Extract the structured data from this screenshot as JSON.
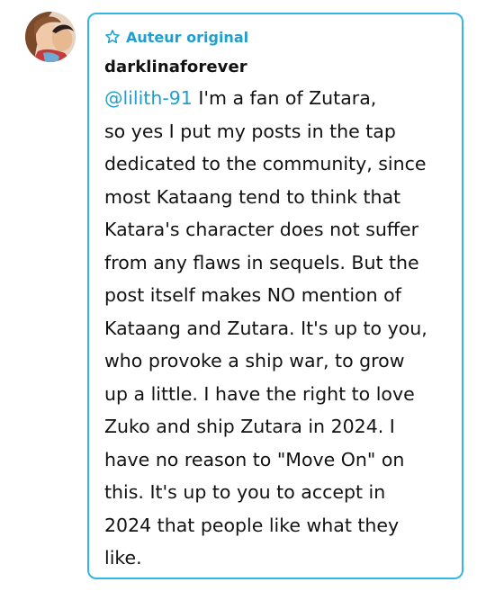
{
  "post": {
    "badge_icon": "star-outline-icon",
    "badge_label": "Auteur original",
    "username": "darklinaforever",
    "mention": "@lilith-91",
    "lines": [
      " I'm a fan of Zutara,",
      "so yes I put my posts in the tap",
      "dedicated to the community, since",
      "most Kataang tend to think that",
      "Katara's character does not suffer",
      "from any flaws in sequels. But the",
      "post itself makes NO mention of",
      "Kataang and Zutara. It's up to you,",
      "who provoke a ship war, to grow",
      "up a little. I have the right to love",
      "Zuko and ship Zutara in 2024. I",
      "have no reason to \"Move On\" on",
      "this. It's up to you to accept in",
      "2024 that people like what they",
      "like."
    ]
  },
  "colors": {
    "accent": "#33b5e5",
    "accent_text": "#1f9fd0",
    "text": "#121212"
  }
}
